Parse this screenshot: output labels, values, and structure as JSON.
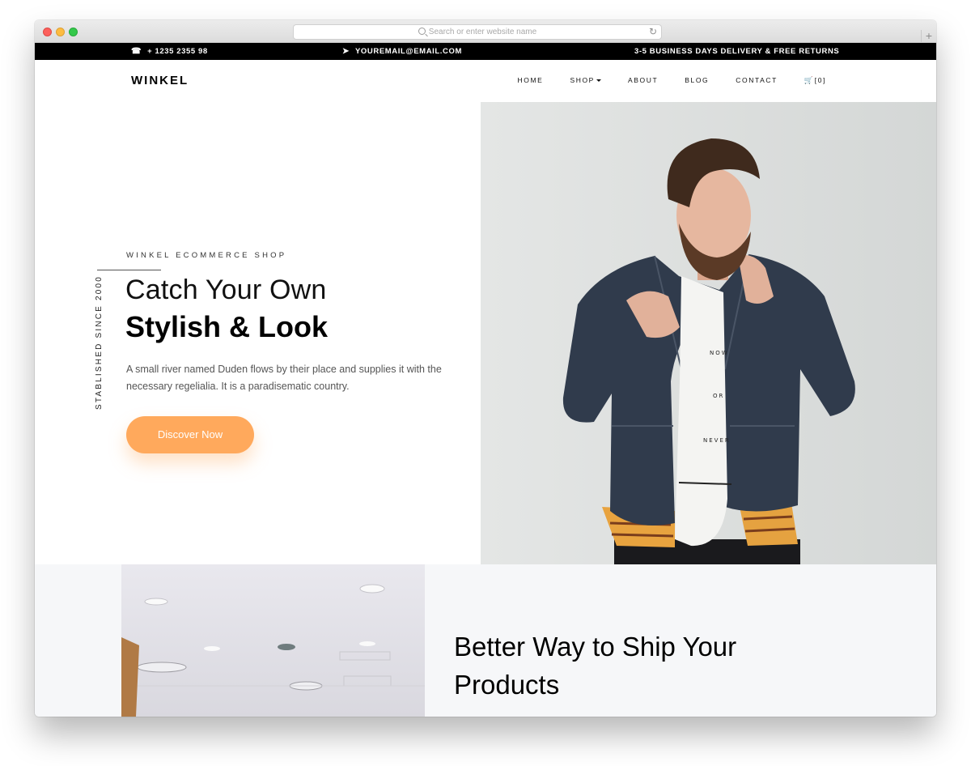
{
  "browser": {
    "url_placeholder": "Search or enter website name",
    "reload_glyph": "↻",
    "newtab_glyph": "+"
  },
  "topbar": {
    "phone": "+ 1235 2355 98",
    "email": "YOUREMAIL@EMAIL.COM",
    "shipping": "3-5 BUSINESS DAYS DELIVERY & FREE RETURNS",
    "phone_icon": "☎",
    "email_icon": "➤"
  },
  "nav": {
    "logo": "WINKEL",
    "items": [
      "HOME",
      "SHOP",
      "ABOUT",
      "BLOG",
      "CONTACT"
    ],
    "cart_label": "[0]",
    "cart_icon": "🛒"
  },
  "hero": {
    "kicker": "WINKEL ECOMMERCE SHOP",
    "title_light": "Catch Your Own",
    "title_bold": "Stylish & Look",
    "description": "A small river named Duden flows by their place and supplies it with the necessary regelialia. It is a paradisematic country.",
    "cta": "Discover Now",
    "vertical_label": "STABLISHED SINCE 2000",
    "shirt_words": [
      "NOW",
      "OR",
      "NEVER"
    ]
  },
  "section2": {
    "title": "Better Way to Ship Your Products"
  },
  "colors": {
    "accent": "#ffa95c",
    "topbar_bg": "#000000",
    "section_bg": "#f6f7f9"
  }
}
